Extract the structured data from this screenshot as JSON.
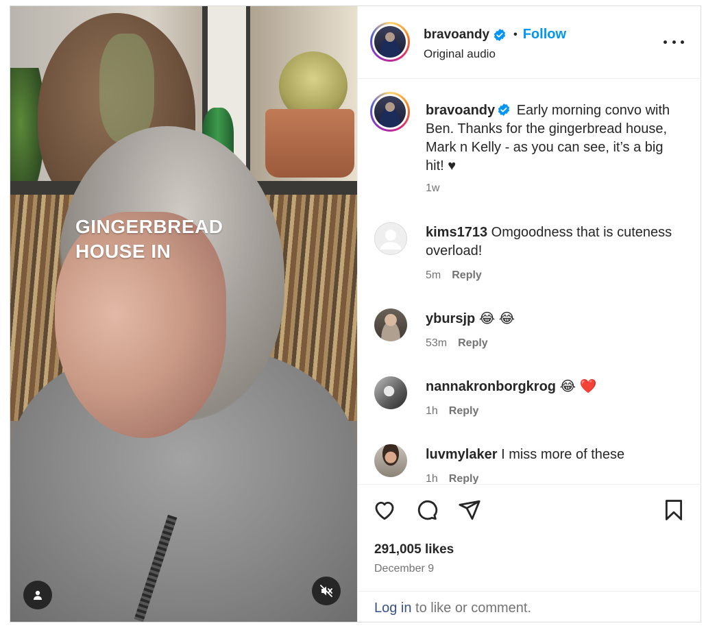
{
  "video": {
    "overlay_lines": [
      "GINGERBREAD",
      "HOUSE IN"
    ],
    "tag_icon": "person-icon",
    "mute_icon": "speaker-muted-icon"
  },
  "header": {
    "username": "bravoandy",
    "separator": "•",
    "follow_label": "Follow",
    "audio_label": "Original audio",
    "more_icon": "more-options-icon"
  },
  "caption": {
    "username": "bravoandy",
    "text": "Early morning convo with Ben. Thanks for the gingerbread house, Mark n Kelly - as you can see, it’s a big hit! ♥",
    "time": "1w"
  },
  "comments": [
    {
      "username": "kims1713",
      "text": "Omgoodness that is cuteness overload!",
      "time": "5m",
      "reply_label": "Reply"
    },
    {
      "username": "ybursjp",
      "text": "😂 😂",
      "time": "53m",
      "reply_label": "Reply"
    },
    {
      "username": "nannakronborgkrog",
      "text": "😂 ❤️",
      "time": "1h",
      "reply_label": "Reply"
    },
    {
      "username": "luvmylaker",
      "text": "I miss more of these",
      "time": "1h",
      "reply_label": "Reply"
    }
  ],
  "actions": {
    "like_icon": "heart-icon",
    "comment_icon": "comment-icon",
    "share_icon": "send-icon",
    "save_icon": "bookmark-icon"
  },
  "stats": {
    "likes": "291,005 likes",
    "date": "December 9"
  },
  "login": {
    "link_text": "Log in",
    "rest_text": " to like or comment."
  },
  "colors": {
    "accent": "#0095f6",
    "verified": "#0095f6",
    "text": "#262626",
    "muted": "#737373"
  }
}
